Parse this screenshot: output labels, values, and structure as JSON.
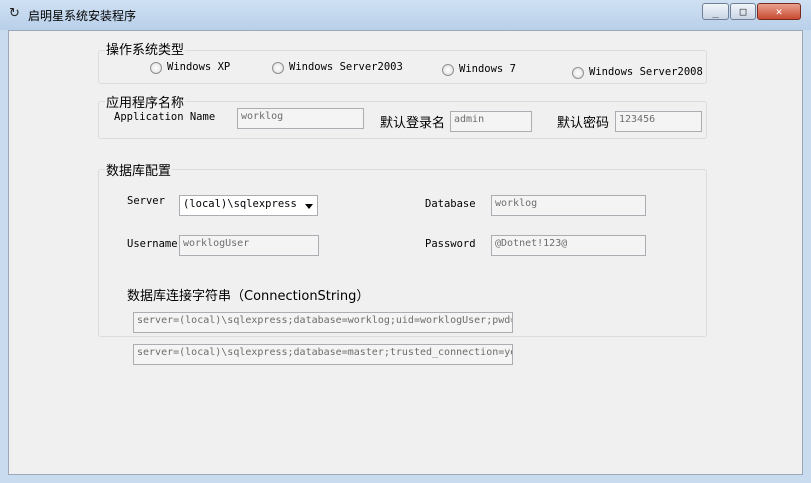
{
  "window": {
    "title": "启明星系统安装程序",
    "min_glyph": "_",
    "max_glyph": "□",
    "close_glyph": "✕"
  },
  "os_group": {
    "title": "操作系统类型",
    "options": [
      {
        "label": "Windows XP",
        "checked": false
      },
      {
        "label": "Windows Server2003",
        "checked": false
      },
      {
        "label": "Windows 7",
        "checked": false
      },
      {
        "label": "Windows Server2008",
        "checked": false
      }
    ]
  },
  "app_group": {
    "title": "应用程序名称",
    "app_name_label": "Application Name",
    "app_name_value": "worklog",
    "login_label": "默认登录名",
    "login_value": "admin",
    "password_label": "默认密码",
    "password_value": "123456"
  },
  "db_group": {
    "title": "数据库配置",
    "server_label": "Server",
    "server_value": "(local)\\sqlexpress",
    "database_label": "Database",
    "database_value": "worklog",
    "username_label": "Username",
    "username_value": "worklogUser",
    "password_label": "Password",
    "password_value": "@Dotnet!123@",
    "connstr_label": "数据库连接字符串（ConnectionString）",
    "connstr_value": "server=(local)\\sqlexpress;database=worklog;uid=worklogUser;pwd=",
    "master_connstr_value": "server=(local)\\sqlexpress;database=master;trusted_connection=yes"
  },
  "icons": {
    "app_icon": "refresh-arrow-icon",
    "dropdown_icon": "chevron-down-icon"
  }
}
